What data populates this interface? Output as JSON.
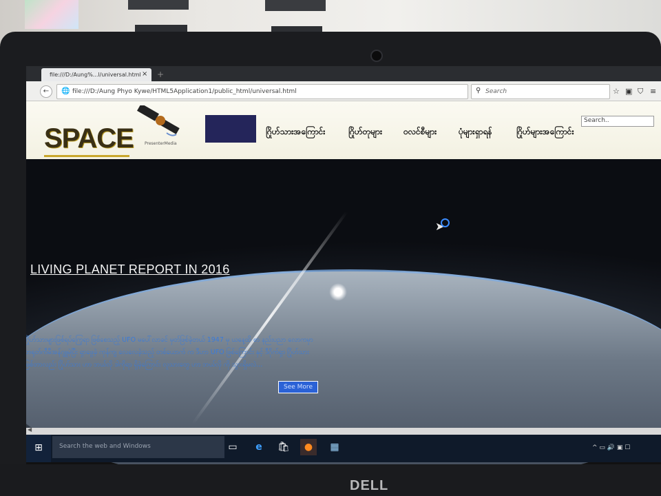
{
  "browser": {
    "tab_title": "file:///D:/Aung%...l/universal.html",
    "tab_close": "×",
    "new_tab": "+",
    "back": "←",
    "globe": "🌐",
    "url": "file:///D:/Aung Phyo Kywe/HTML5Application1/public_html/universal.html",
    "reload": "C",
    "search_icon": "⚲",
    "search_placeholder": "Search",
    "toolbar_icons": [
      "☆",
      "▣",
      "⛉",
      "≡"
    ]
  },
  "site": {
    "logo": "SPACE",
    "presenter_brand": "PresenterMedia",
    "nav": [
      "ဂြိုဟ်သားအကြောင်း",
      "ဂြိုဟ်တုများ",
      "ဝလင်စီများ",
      "ပုံများရှာရန်",
      "ဂြိုဟ်များအကြောင်း"
    ],
    "search_placeholder": "Search..",
    "hero_title": "LIVING PLANET REPORT IN 2016",
    "hero_text": "ဂြိုဟ်သားများဖြစ်ရပ်ကြွေရာ ဖြစ်စေသည့် UFO မပေါ်လာခင် မှတ်ဖြစ်ခဲ့တယ် 1947 မှ ယနေ့ထိ စာ နည်းပညာ လောကမှာ တရုတ်ကီမီအန်ဂျူမဲ့ပြီး ရှာဖွေခဲ့ ကုန်ကျ လေလေခဲ့သည့် တစ်ယောက် က ဒီဟာ UFO ဖြစ်ကြောင်း နှင့် ဒီဂိုက်ရှာ ဂြိုဟ်သားဖြစ်တာလည်း ဂြိုဟ်သား ဟာ ဘယ်လို ဒါကိုရာ ရှိခဲ့ကြောင်း လူသားတွေ ဟာ ဘယ်လို ကို သွားရှိမလဲ...",
    "see_more": "See More"
  },
  "taskbar": {
    "start": "⊞",
    "search_placeholder": "Search the web and Windows",
    "apps": [
      "▭",
      "e",
      "🛍",
      "●",
      "▦"
    ],
    "tray": "^  ▭  🔊  ▣  ☐"
  },
  "device": {
    "brand": "DELL"
  }
}
